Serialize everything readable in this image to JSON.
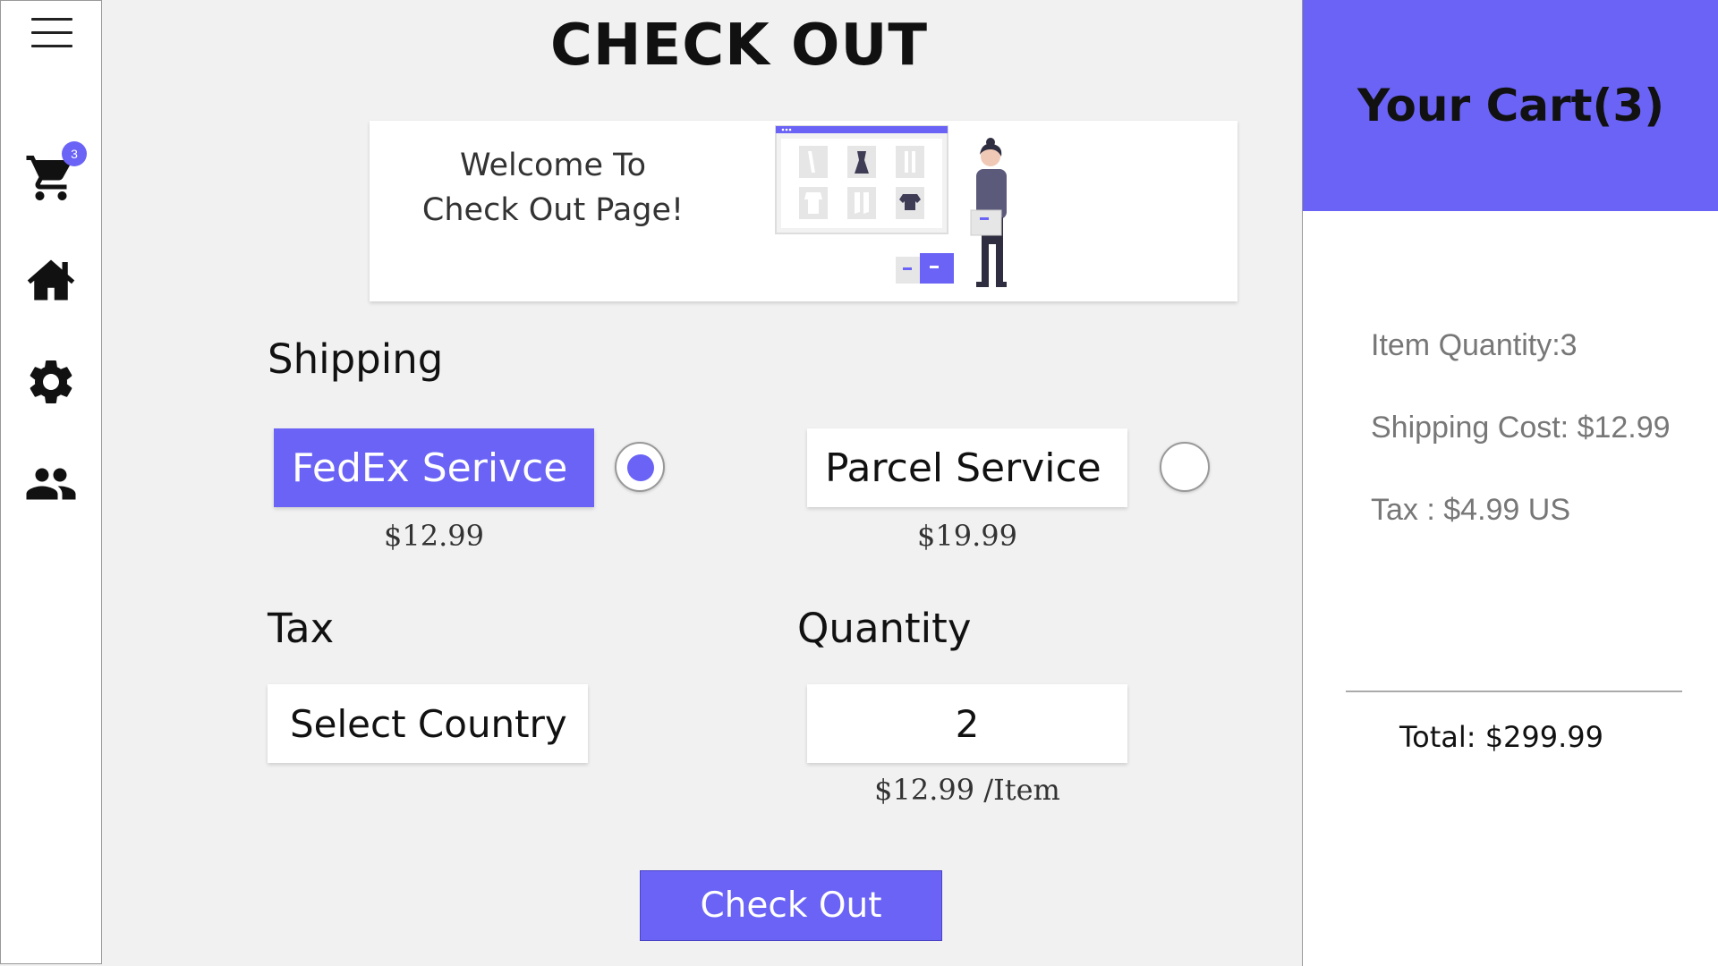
{
  "sidebar": {
    "cart_badge_count": "3",
    "icons": [
      "menu-icon",
      "cart-icon",
      "home-icon",
      "gear-icon",
      "users-icon"
    ]
  },
  "page": {
    "title": "CHECK OUT"
  },
  "banner": {
    "line1": "Welcome To",
    "line2": "Check Out Page!"
  },
  "shipping": {
    "heading": "Shipping",
    "options": [
      {
        "label": "FedEx Serivce",
        "price": "$12.99",
        "selected": true
      },
      {
        "label": "Parcel Service",
        "price": "$19.99",
        "selected": false
      }
    ]
  },
  "tax": {
    "heading": "Tax",
    "select_label": "Select Country"
  },
  "quantity": {
    "heading": "Quantity",
    "value": "2",
    "unit_price": "$12.99 /Item"
  },
  "checkout_button": {
    "label": "Check Out"
  },
  "cart": {
    "title": "Your Cart(3)",
    "item_quantity": "Item Quantity:3",
    "shipping_cost": "Shipping Cost: $12.99",
    "tax": "Tax : $4.99 US",
    "total": "Total: $299.99"
  },
  "colors": {
    "accent": "#6a63f6",
    "background": "#f1f1f1",
    "panel": "#ffffff"
  }
}
